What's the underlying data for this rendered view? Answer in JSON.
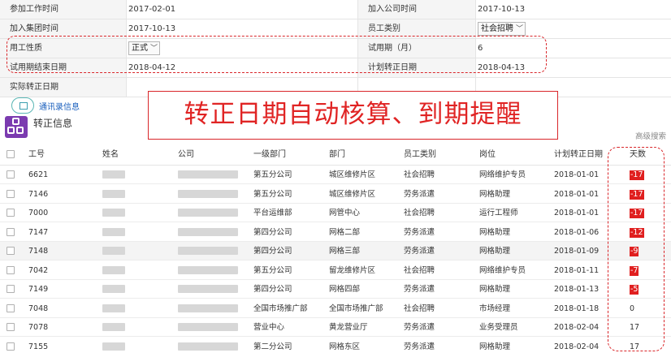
{
  "form": {
    "rows": [
      {
        "l1": "参加工作时间",
        "v1": "2017-02-01",
        "l2": "加入公司时间",
        "v2": "2017-10-13"
      },
      {
        "l1": "加入集团时间",
        "v1": "2017-10-13",
        "l2": "员工类别",
        "v2": "社会招聘"
      },
      {
        "l1": "用工性质",
        "v1": "正式",
        "l2": "试用期（月）",
        "v2": "6"
      },
      {
        "l1": "试用期结束日期",
        "v1": "2018-04-12",
        "l2": "计划转正日期",
        "v2": "2018-04-13"
      },
      {
        "l1": "实际转正日期",
        "v1": "",
        "l2": "",
        "v2": ""
      }
    ]
  },
  "contact_link": "通讯录信息",
  "callout": "转正日期自动核算、到期提醒",
  "section_title": "转正信息",
  "advanced_search": "高级搜索",
  "colors": {
    "accent_red": "#e01f1f",
    "section_icon": "#7b3bb0",
    "link": "#1a5fbd"
  },
  "table": {
    "headers": [
      "工号",
      "姓名",
      "公司",
      "一级部门",
      "部门",
      "员工类别",
      "岗位",
      "计划转正日期",
      "天数"
    ],
    "rows": [
      {
        "id": "6621",
        "dept1": "第五分公司",
        "dept": "城区维修片区",
        "type": "社会招聘",
        "post": "网络维护专员",
        "date": "2018-01-01",
        "days": "-17",
        "neg": true
      },
      {
        "id": "7146",
        "dept1": "第五分公司",
        "dept": "城区维修片区",
        "type": "劳务派遣",
        "post": "网格助理",
        "date": "2018-01-01",
        "days": "-17",
        "neg": true
      },
      {
        "id": "7000",
        "dept1": "平台运维部",
        "dept": "网管中心",
        "type": "社会招聘",
        "post": "运行工程师",
        "date": "2018-01-01",
        "days": "-17",
        "neg": true
      },
      {
        "id": "7147",
        "dept1": "第四分公司",
        "dept": "网格二部",
        "type": "劳务派遣",
        "post": "网格助理",
        "date": "2018-01-06",
        "days": "-12",
        "neg": true
      },
      {
        "id": "7148",
        "dept1": "第四分公司",
        "dept": "网格三部",
        "type": "劳务派遣",
        "post": "网格助理",
        "date": "2018-01-09",
        "days": "-9",
        "neg": true
      },
      {
        "id": "7042",
        "dept1": "第五分公司",
        "dept": "留龙维修片区",
        "type": "社会招聘",
        "post": "网络维护专员",
        "date": "2018-01-11",
        "days": "-7",
        "neg": true
      },
      {
        "id": "7149",
        "dept1": "第四分公司",
        "dept": "网格四部",
        "type": "劳务派遣",
        "post": "网格助理",
        "date": "2018-01-13",
        "days": "-5",
        "neg": true
      },
      {
        "id": "7048",
        "dept1": "全国市场推广部",
        "dept": "全国市场推广部",
        "type": "社会招聘",
        "post": "市场经理",
        "date": "2018-01-18",
        "days": "0",
        "neg": false
      },
      {
        "id": "7078",
        "dept1": "营业中心",
        "dept": "黄龙营业厅",
        "type": "劳务派遣",
        "post": "业务受理员",
        "date": "2018-02-04",
        "days": "17",
        "neg": false
      },
      {
        "id": "7155",
        "dept1": "第二分公司",
        "dept": "网格东区",
        "type": "劳务派遣",
        "post": "网格助理",
        "date": "2018-02-04",
        "days": "17",
        "neg": false
      }
    ]
  }
}
